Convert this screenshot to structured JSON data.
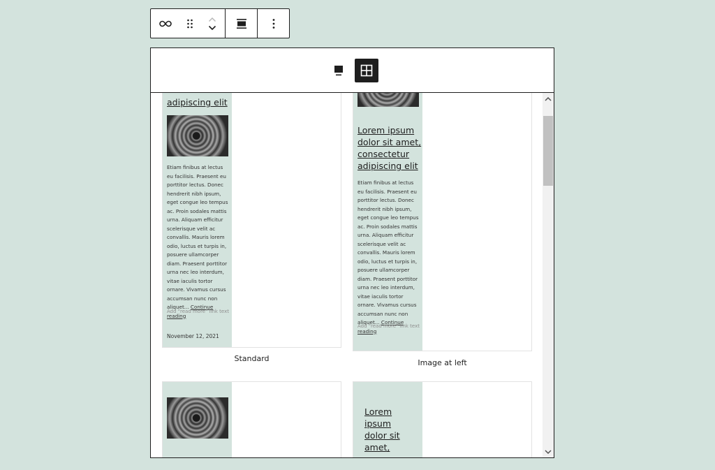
{
  "posts": {
    "title_line_end": "adipiscing elit",
    "title_full_lines": [
      "Lorem ipsum",
      "dolor sit amet,",
      "consectetur",
      "adipiscing elit"
    ],
    "title_narrow_lines": [
      "Lorem",
      "ipsum",
      "dolor sit",
      "amet,"
    ],
    "excerpt": "Etiam finibus at lectus eu facilisis. Praesent eu porttitor lectus. Donec hendrerit nibh ipsum, eget congue leo tempus ac. Proin sodales mattis urna. Aliquam efficitur scelerisque velit ac convallis. Mauris lorem odio, luctus et turpis in, posuere ullamcorper diam. Praesent porttitor urna nec leo interdum, vitae iaculis tortor ornare. Vivamus cursus accumsan nunc non aliquet...",
    "continue_reading": "Continue reading",
    "read_more_placeholder": "Add \"read more\" link text",
    "date": "November 12, 2021"
  },
  "patterns": {
    "standard_label": "Standard",
    "image_left_label": "Image at left"
  },
  "icons": {
    "link": "link-icon",
    "drag": "drag-handle-icon",
    "move_up": "chevron-up-icon",
    "move_down": "chevron-down-icon",
    "align": "align-full-icon",
    "more": "more-vertical-icon",
    "carousel": "carousel-view-icon",
    "grid": "grid-view-icon"
  }
}
